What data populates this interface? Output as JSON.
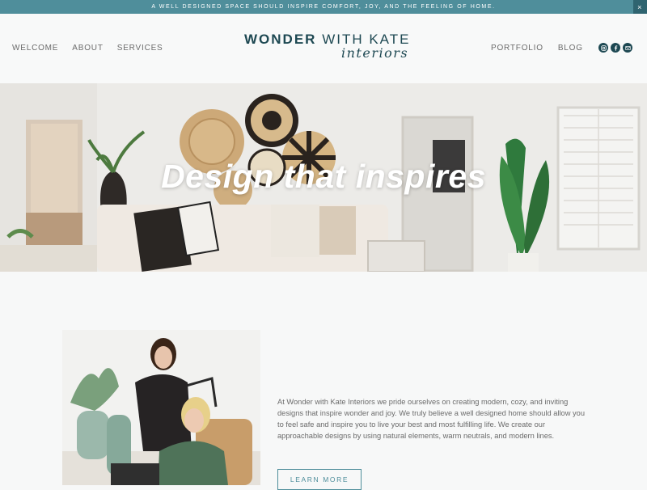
{
  "announcement": {
    "text": "A well designed space should inspire comfort, joy, and the feeling of home.",
    "close_label": "×"
  },
  "nav": {
    "left": [
      "WELCOME",
      "ABOUT",
      "SERVICES"
    ],
    "right": [
      "PORTFOLIO",
      "BLOG"
    ]
  },
  "logo": {
    "word1": "WONDER",
    "word2": "WITH KATE",
    "script": "interiors"
  },
  "social": [
    "instagram-icon",
    "facebook-icon",
    "email-icon"
  ],
  "hero": {
    "title": "Design that inspires"
  },
  "about": {
    "text": "At Wonder with Kate Interiors we pride ourselves on creating modern, cozy, and inviting designs that inspire wonder and joy. We truly believe a well designed home should allow you to feel safe and inspire you to live your best and most fulfilling life. We create our approachable designs by using natural elements, warm neutrals, and modern lines.",
    "button_label": "LEARN MORE"
  },
  "colors": {
    "teal": "#4f8e9b",
    "navy": "#1d4852",
    "background": "#f7f8f8"
  }
}
